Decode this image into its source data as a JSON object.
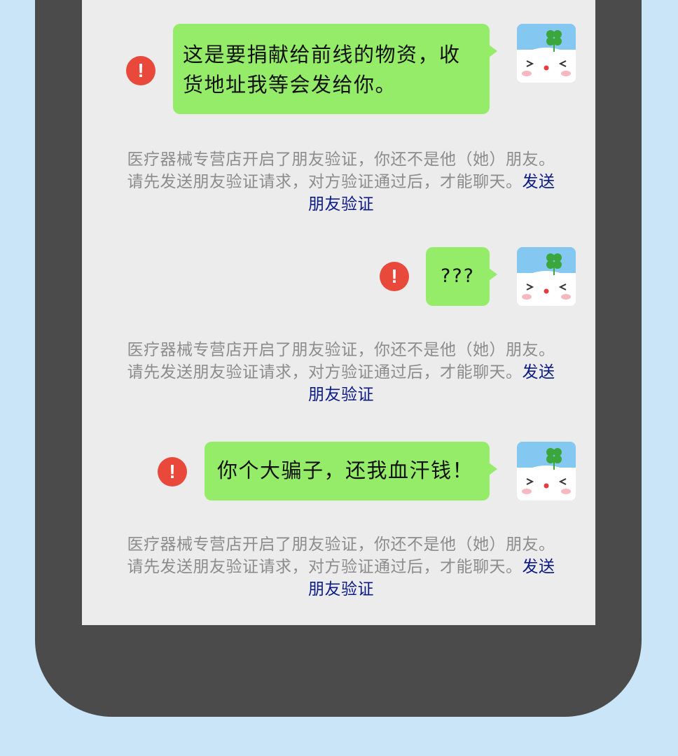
{
  "messages": [
    {
      "text": "这是要捐献给前线的物资，收货地址我等会发给你。"
    },
    {
      "text": "???"
    },
    {
      "text": "你个大骗子，还我血汗钱！"
    }
  ],
  "notice": {
    "text": "医疗器械专营店开启了朋友验证，你还不是他（她）朋友。请先发送朋友验证请求，对方验证通过后，才能聊天。",
    "link": "发送朋友验证"
  },
  "alert_icon": {
    "glyph": "!",
    "color": "#e8493a"
  },
  "colors": {
    "background": "#c9e5f7",
    "phone_frame": "#4b4b4c",
    "chat_background": "#ececec",
    "bubble": "#95ec69",
    "notice_text": "#8c8c8c",
    "link": "#0b1a86"
  }
}
